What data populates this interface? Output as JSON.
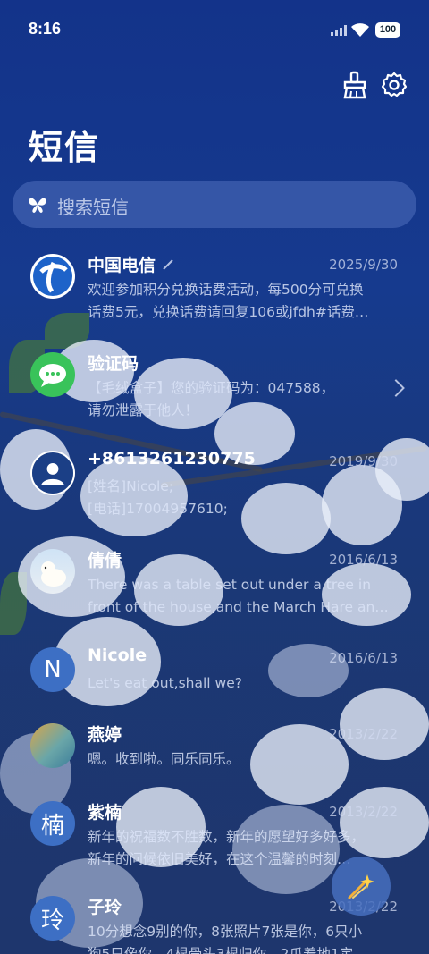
{
  "status_bar": {
    "time": "8:16",
    "battery": "100"
  },
  "page": {
    "title": "短信"
  },
  "search": {
    "placeholder": "搜索短信"
  },
  "messages": [
    {
      "name": "中国电信",
      "date": "2025/9/30",
      "line1": "欢迎参加积分兑换话费活动，每500分可兑换",
      "line2": "话费5元，兑换话费请回复106或jfdh#话费…",
      "avatar": "china-telecom-logo"
    },
    {
      "name": "验证码",
      "date": "",
      "line1": "【毛绒盒子】您的验证码为：047588，",
      "line2": "请勿泄露于他人！",
      "avatar": "sms-bubble-icon"
    },
    {
      "name": "+8613261230775",
      "date": "2019/9/30",
      "line1": "[姓名]Nicole;",
      "line2": "[电话]17004957610;",
      "avatar": "person-photo"
    },
    {
      "name": "倩倩",
      "date": "2016/6/13",
      "line1": "There was a table set out under a tree in",
      "line2": "front of the house,and the March Hare an…",
      "avatar": "polar-bear-photo"
    },
    {
      "name": "Nicole",
      "date": "2016/6/13",
      "line1": "Let's eat out,shall we?",
      "line2": "",
      "avatar_letter": "N"
    },
    {
      "name": "燕婷",
      "date": "2013/2/22",
      "line1": "嗯。收到啦。同乐同乐。",
      "line2": "",
      "avatar": "landscape-photo"
    },
    {
      "name": "紫楠",
      "date": "2013/2/22",
      "line1": "新年的祝福数不胜数，新年的愿望好多好多，",
      "line2": "新年的问候依旧美好，在这个温馨的时刻…",
      "avatar_letter": "楠"
    },
    {
      "name": "子玲",
      "date": "2013/2/22",
      "line1": "10分想念9别的你，8张照片7张是你，6只小",
      "line2": "狗5只像你，4根骨头3根归你，2爪着地1定…",
      "avatar_letter": "玲"
    }
  ],
  "colors": {
    "background": "#163a8e",
    "avatar_blue": "#3d6fc4",
    "sms_green": "#39c35a"
  }
}
